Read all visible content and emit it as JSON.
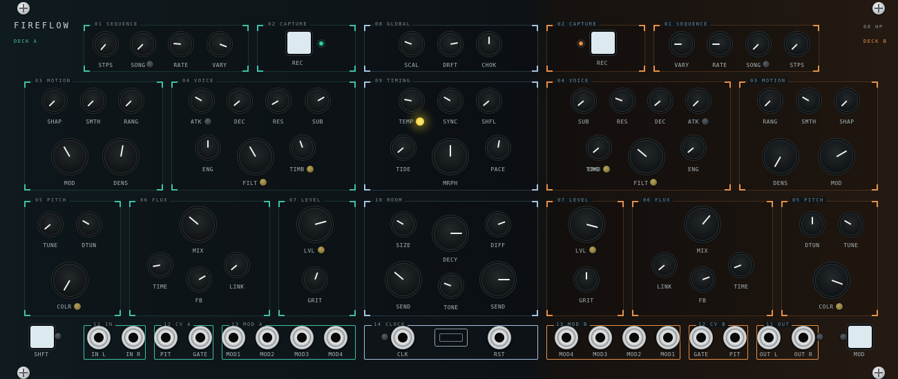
{
  "brand": {
    "name": "FIREFLOW",
    "deck_a": "DECK A",
    "hp": "68 HP",
    "deck_b": "DECK B"
  },
  "colors": {
    "teal": "#3fc3a8",
    "blue": "#a7c4e3",
    "orange": "#e8924a",
    "led_yellow": "#f7df3a",
    "button": "#dceaf0"
  },
  "sections": {
    "seq_a": "01 SEQUENCE",
    "capture_a": "02 CAPTURE",
    "global": "08 GLOBAL",
    "capture_b": "02 CAPTURE",
    "seq_b": "01 SEQUENCE",
    "motion_a": "03 MOTION",
    "voice_a": "04 VOICE",
    "timing": "09 TIMING",
    "voice_b": "04 VOICE",
    "motion_b": "03 MOTION",
    "pitch_a": "05 PITCH",
    "flux_a": "06 FLUX",
    "level_a": "07 LEVEL",
    "room": "10 ROOM",
    "level_b": "07 LEVEL",
    "flux_b": "06 FLUX",
    "pitch_b": "05 PITCH",
    "in_a": "11 IN",
    "cv_a": "12 CV A",
    "mod_a": "13 MOD A",
    "clock": "14 CLOCK",
    "mod_b": "13 MOD B",
    "cv_b": "12 CV B",
    "out": "11 OUT"
  },
  "labels": {
    "stps": "STPS",
    "song": "SONG",
    "rate": "RATE",
    "vary": "VARY",
    "rec": "REC",
    "scal": "SCAL",
    "drft": "DRFT",
    "chok": "CHOK",
    "shap": "SHAP",
    "smth": "SMTH",
    "rang": "RANG",
    "mod": "MOD",
    "dens": "DENS",
    "atk": "ATK",
    "dec": "DEC",
    "res": "RES",
    "sub": "SUB",
    "eng": "ENG",
    "filt": "FILT",
    "timb": "TIMB",
    "temp": "TEMP",
    "sync": "SYNC",
    "shfl": "SHFL",
    "tide": "TIDE",
    "mrph": "MRPH",
    "pace": "PACE",
    "tune": "TUNE",
    "dtun": "DTUN",
    "colr": "COLR",
    "mix": "MIX",
    "time": "TIME",
    "link": "LINK",
    "fb": "FB",
    "lvl": "LVL",
    "grit": "GRIT",
    "size": "SIZE",
    "decy": "DECY",
    "diff": "DIFF",
    "send": "SEND",
    "tone": "TONE",
    "shft": "SHFT",
    "in_l": "IN L",
    "in_r": "IN R",
    "pit": "PIT",
    "gate": "GATE",
    "mod1": "MOD1",
    "mod2": "MOD2",
    "mod3": "MOD3",
    "mod4": "MOD4",
    "clk": "CLK",
    "rst": "RST",
    "out_l": "OUT L",
    "out_r": "OUT R",
    "mod_btn": "MOD"
  }
}
